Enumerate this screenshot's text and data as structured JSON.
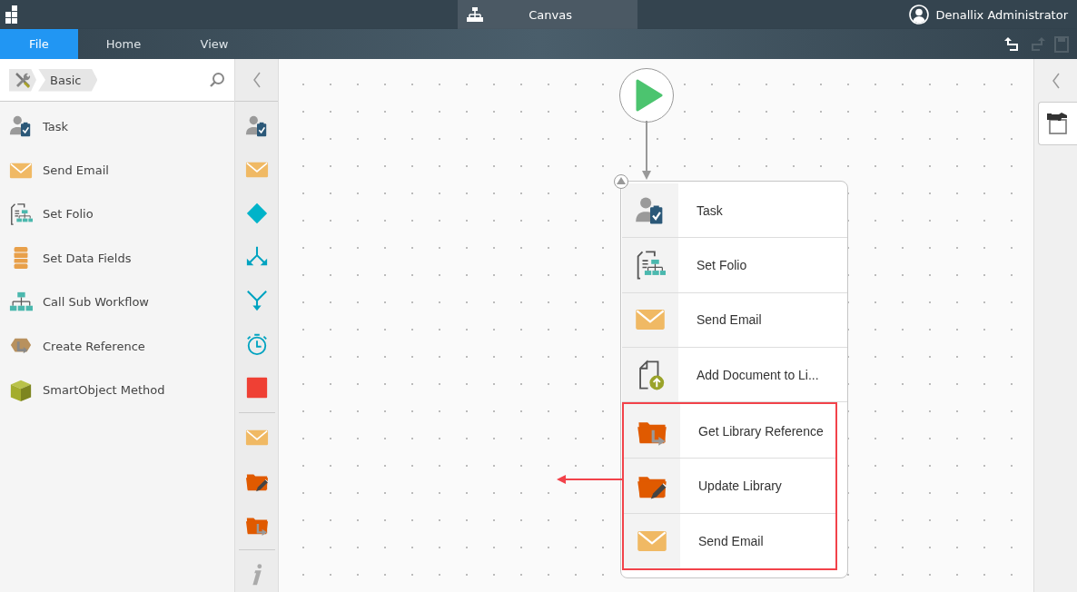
{
  "top_bar": {
    "title": "Canvas",
    "user": "Denallix Administrator"
  },
  "ribbon": {
    "tabs": [
      {
        "label": "File",
        "selected": true
      },
      {
        "label": "Home",
        "selected": false
      },
      {
        "label": "View",
        "selected": false
      }
    ],
    "actions": [
      {
        "kind": "undo",
        "disabled": false
      },
      {
        "kind": "redo",
        "disabled": true
      },
      {
        "kind": "save",
        "disabled": true
      }
    ]
  },
  "toolbox": {
    "category": "Basic",
    "items": [
      {
        "label": "Task",
        "kind": "task"
      },
      {
        "label": "Send Email",
        "kind": "email"
      },
      {
        "label": "Set Folio",
        "kind": "folio"
      },
      {
        "label": "Set Data Fields",
        "kind": "datafields"
      },
      {
        "label": "Call Sub Workflow",
        "kind": "subworkflow"
      },
      {
        "label": "Create Reference",
        "kind": "reference"
      },
      {
        "label": "SmartObject Method",
        "kind": "smartobject"
      }
    ]
  },
  "quick_strip": [
    {
      "kind": "task"
    },
    {
      "kind": "email"
    },
    {
      "kind": "decision"
    },
    {
      "kind": "split"
    },
    {
      "kind": "merge"
    },
    {
      "kind": "timer"
    },
    {
      "kind": "stop"
    },
    {
      "kind": "divider"
    },
    {
      "kind": "email"
    },
    {
      "kind": "update-library"
    },
    {
      "kind": "get-library-ref"
    },
    {
      "kind": "divider"
    },
    {
      "kind": "info"
    }
  ],
  "canvas": {
    "steps": [
      {
        "label": "Task",
        "kind": "task",
        "highlighted": false
      },
      {
        "label": "Set Folio",
        "kind": "folio",
        "highlighted": false
      },
      {
        "label": "Send Email",
        "kind": "email",
        "highlighted": false
      },
      {
        "label": "Add Document to Li...",
        "kind": "add-document",
        "highlighted": false
      },
      {
        "label": "Get Library Reference",
        "kind": "get-library-ref",
        "highlighted": true
      },
      {
        "label": "Update Library",
        "kind": "update-library",
        "highlighted": true
      },
      {
        "label": "Send Email",
        "kind": "email",
        "highlighted": true
      }
    ]
  }
}
